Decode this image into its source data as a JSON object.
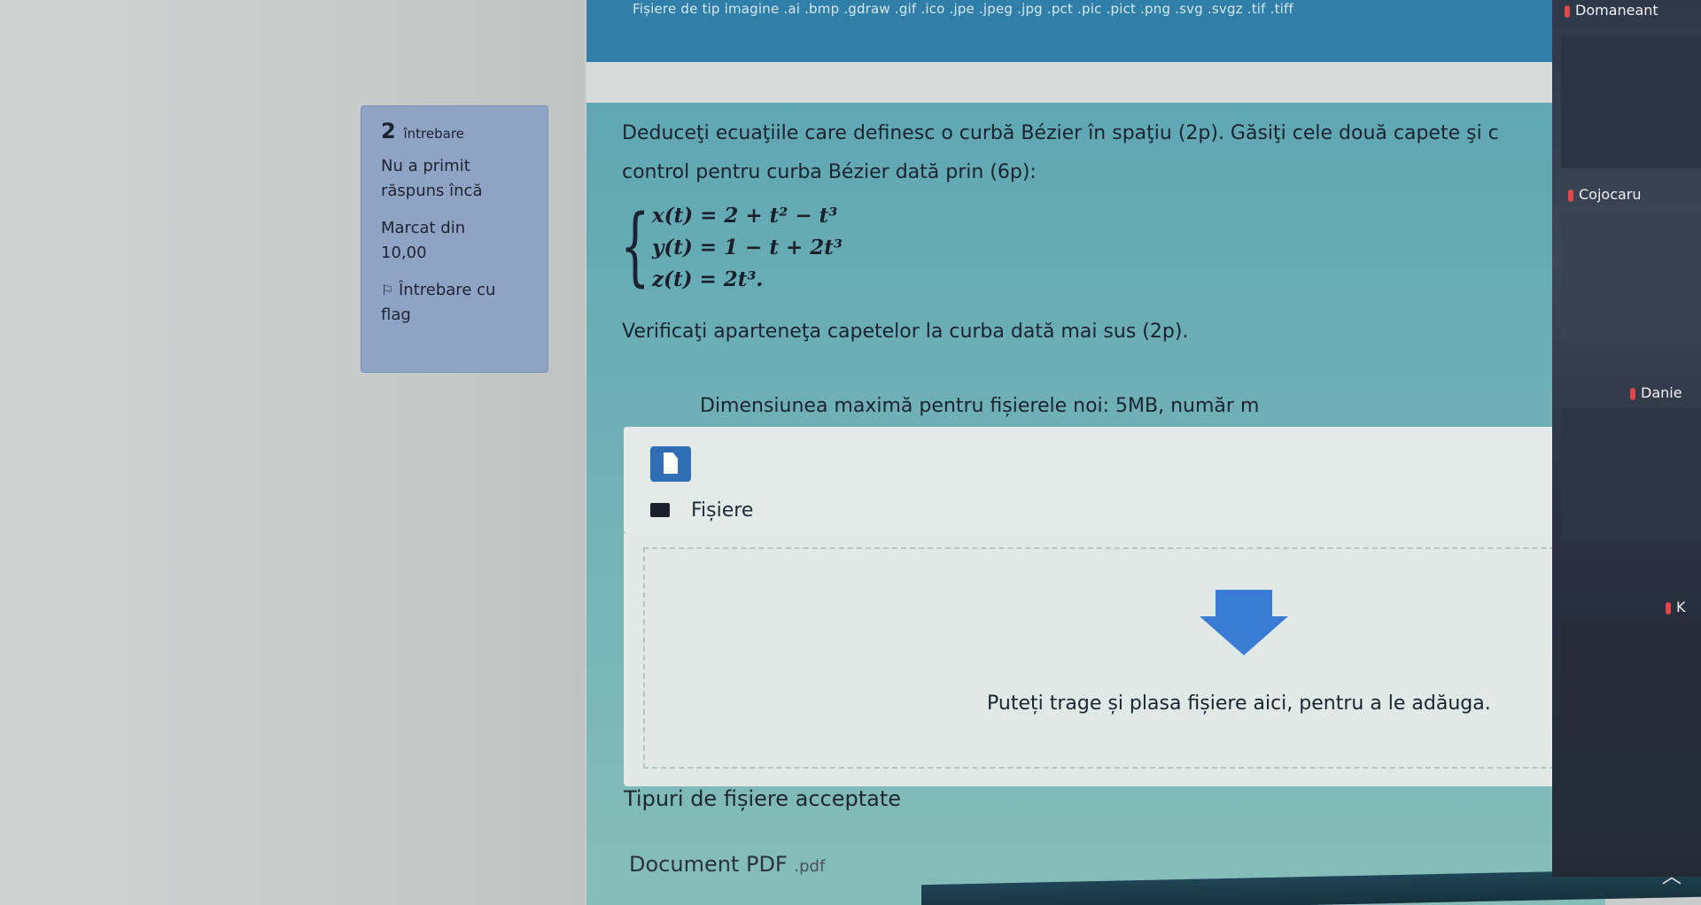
{
  "header": {
    "accepted_types_line": "Fișiere de tip imagine .ai .bmp .gdraw .gif .ico .jpe .jpeg .jpg .pct .pic .pict .png .svg .svgz .tif .tiff"
  },
  "question_info": {
    "number": "2",
    "label": "întrebare",
    "status_line1": "Nu a primit",
    "status_line2": "răspuns încă",
    "mark_line1": "Marcat din",
    "mark_line2": "10,00",
    "flag_line1": "Întrebare cu",
    "flag_line2": "flag"
  },
  "question": {
    "line1": "Deduceţi ecuaţiile care definesc o curbă Bézier în spaţiu (2p). Găsiţi cele două capete şi c",
    "line2": "control pentru curba Bézier dată prin (6p):",
    "eq1": "x(t) = 2 + t² − t³",
    "eq2": "y(t) = 1 − t + 2t³",
    "eq3": "z(t) = 2t³.",
    "line3": "Verificaţi aparteneţa capetelor la curba dată mai sus (2p)."
  },
  "upload": {
    "max_size": "Dimensiunea maximă pentru fișierele noi: 5MB, număr m",
    "files_label": "Fișiere",
    "drop_text": "Puteți trage și plasa fișiere aici, pentru a le adăuga.",
    "accepted_title": "Tipuri de fișiere acceptate",
    "accepted_type": "Document PDF",
    "accepted_ext": ".pdf"
  },
  "video_sidebar": {
    "participant1": "Domaneant",
    "participant2": "Cojocaru",
    "participant3": "Danie",
    "participant4": "K"
  },
  "colors": {
    "panel": "#6fb0b6",
    "info_box": "#8fa3c4",
    "file_icon": "#2f6eb5",
    "banner": "#2f7fa8"
  },
  "icons": {
    "flag": "flag-icon",
    "file": "file-icon",
    "folder": "folder-icon",
    "arrow": "download-arrow-icon",
    "scroll": "chevron-up-icon"
  }
}
